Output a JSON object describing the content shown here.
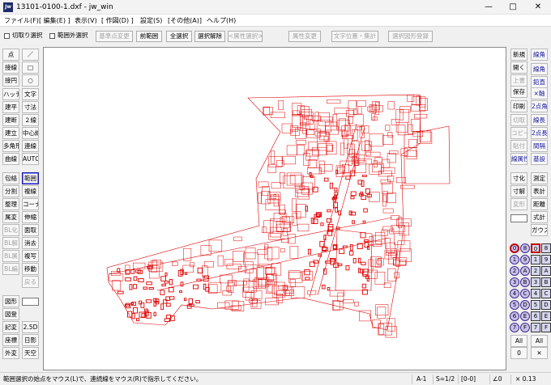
{
  "window": {
    "icon_text": "Jw",
    "title": "13101-0100-1.dxf - jw_win",
    "minimize": "—",
    "maximize": "□",
    "close": "✕"
  },
  "menu": [
    "ファイル(F)",
    "[ 編集(E) ]",
    "表示(V)",
    "[ 作図(D) ]",
    "設定(S)",
    "[その他(A)]",
    "ヘルプ(H)"
  ],
  "toolbar": {
    "crop_select": "切取り選択",
    "out_of_range_select": "範囲外選択",
    "base_point_change": "基準点変更",
    "prev_range": "前範囲",
    "select_all": "全選択",
    "deselect": "選択解除",
    "attr_select": "<属性選択>",
    "attr_change": "属性変更",
    "text_position": "文字位置・集計",
    "register_selection": "選択図形登録"
  },
  "left_tools": {
    "col1": [
      "点",
      "接線",
      "接円",
      "ハッチ",
      "建平",
      "建断",
      "建立",
      "多角形",
      "曲線",
      "包絡",
      "分割",
      "整理",
      "属変",
      "BL化",
      "BL解",
      "BL属",
      "BL編",
      "図形",
      "図登",
      "記変",
      "座標",
      "外変"
    ],
    "col2": [
      "／",
      "□",
      "○",
      "文字",
      "寸法",
      "２線",
      "中心線",
      "連線",
      "AUTO",
      "範囲",
      "複線",
      "コーナー",
      "伸縮",
      "面取",
      "消去",
      "複写",
      "移動",
      "戻る",
      "2.5D",
      "日影",
      "天空"
    ]
  },
  "right_tools": {
    "col1": [
      "新規",
      "開く",
      "上書",
      "保存",
      "印刷",
      "切取",
      "コピー",
      "貼付",
      "線属性",
      "寸化",
      "寸解",
      "変形",
      "式計",
      "ガウス"
    ],
    "col2": [
      "線角",
      "線角",
      "鉛直",
      "×軸",
      "2点角",
      "線長",
      "2点長",
      "間隔",
      "基設",
      "測定",
      "表計",
      "距離"
    ],
    "layers": [
      "0",
      "1",
      "2",
      "3",
      "4",
      "5",
      "6",
      "7",
      "8",
      "9",
      "A",
      "B",
      "C",
      "D",
      "E",
      "F"
    ],
    "groups": [
      "0",
      "8",
      "1",
      "9",
      "2",
      "A",
      "3",
      "B",
      "4",
      "C",
      "5",
      "D",
      "6",
      "E",
      "7",
      "F"
    ],
    "all_layers": "All",
    "all_groups": "All",
    "layer_zero": "0",
    "group_x": "✕"
  },
  "status": {
    "message": "範囲選択の始点をマウス(L)で、連続線をマウス(R)で指示してください。",
    "paper": "A-1",
    "scale": "S=1/2",
    "layer": "[0-0]",
    "angle": "∠0",
    "zoom": "× 0.13"
  },
  "colors": {
    "drawing": "#e00000",
    "accent": "#1a1aa0"
  }
}
